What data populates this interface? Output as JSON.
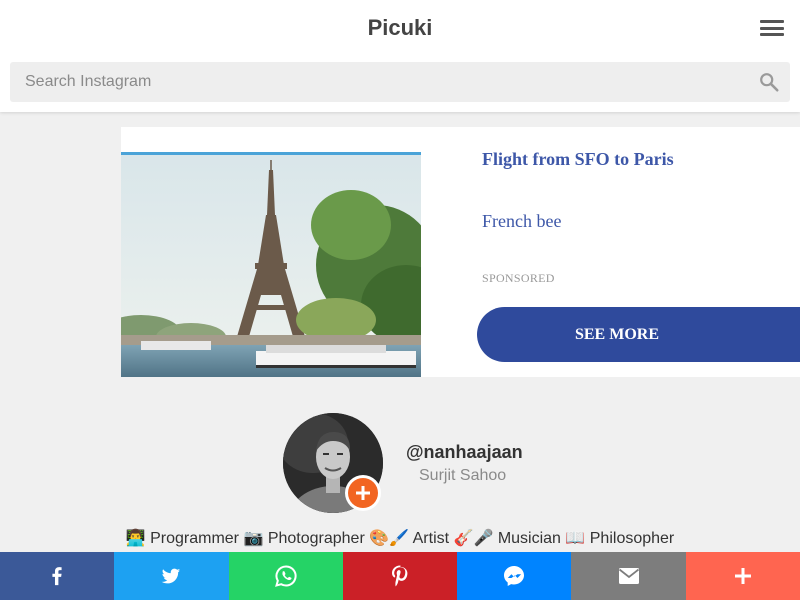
{
  "header": {
    "site_title": "Picuki",
    "menu_icon": "hamburger-menu-icon"
  },
  "search": {
    "placeholder": "Search Instagram",
    "value": "",
    "icon": "search-icon"
  },
  "ad": {
    "title": "Flight from SFO to Paris",
    "advertiser": "French bee",
    "sponsored_label": "SPONSORED",
    "cta_label": "SEE MORE",
    "image": "eiffel-tower-photo",
    "accent_color": "#2f4a9c",
    "link_color": "#3d57a8"
  },
  "profile": {
    "username": "@nanhaajaan",
    "full_name": "Surjit Sahoo",
    "bio": "👨‍💻 Programmer 📷 Photographer 🎨🖌️ Artist 🎸🎤 Musician 📖 Philosopher",
    "follow_icon": "plus-icon",
    "follow_color": "#f26522"
  },
  "share": [
    {
      "network": "facebook",
      "icon": "facebook-icon",
      "color": "#3b5998"
    },
    {
      "network": "twitter",
      "icon": "twitter-icon",
      "color": "#1da1f2"
    },
    {
      "network": "whatsapp",
      "icon": "whatsapp-icon",
      "color": "#25d366"
    },
    {
      "network": "pinterest",
      "icon": "pinterest-icon",
      "color": "#cb2027"
    },
    {
      "network": "messenger",
      "icon": "messenger-icon",
      "color": "#0084ff"
    },
    {
      "network": "email",
      "icon": "email-icon",
      "color": "#7d7d7d"
    },
    {
      "network": "more",
      "icon": "plus-icon",
      "color": "#ff6550"
    }
  ]
}
